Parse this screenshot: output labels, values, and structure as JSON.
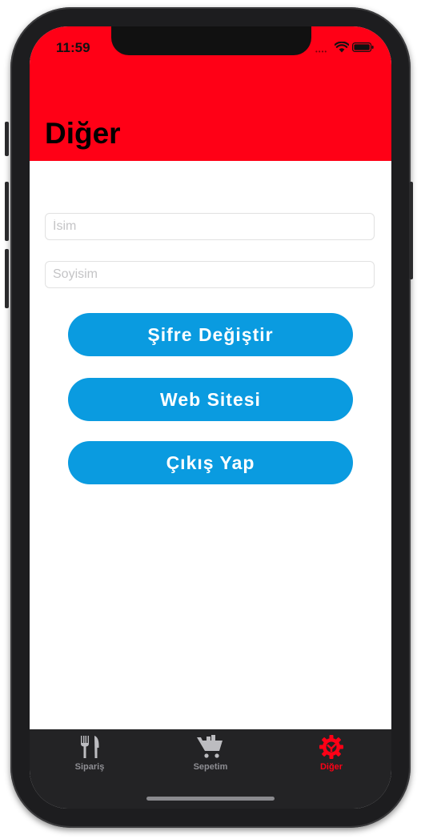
{
  "status_bar": {
    "time": "11:59"
  },
  "header": {
    "title": "Diğer",
    "background_color": "#ff0016"
  },
  "form": {
    "first_name": {
      "value": "",
      "placeholder": "İsim"
    },
    "last_name": {
      "value": "",
      "placeholder": "Soyisim"
    }
  },
  "buttons": {
    "change_password": "Şifre Değiştir",
    "website": "Web Sitesi",
    "logout": "Çıkış Yap",
    "color": "#0a9be0"
  },
  "tabbar": {
    "items": [
      {
        "label": "Sipariş",
        "icon": "fork-knife-icon",
        "active": false
      },
      {
        "label": "Sepetim",
        "icon": "cart-icon",
        "active": false
      },
      {
        "label": "Diğer",
        "icon": "gear-icon",
        "active": true
      }
    ],
    "active_color": "#ff0016",
    "inactive_color": "#8e8e93"
  }
}
